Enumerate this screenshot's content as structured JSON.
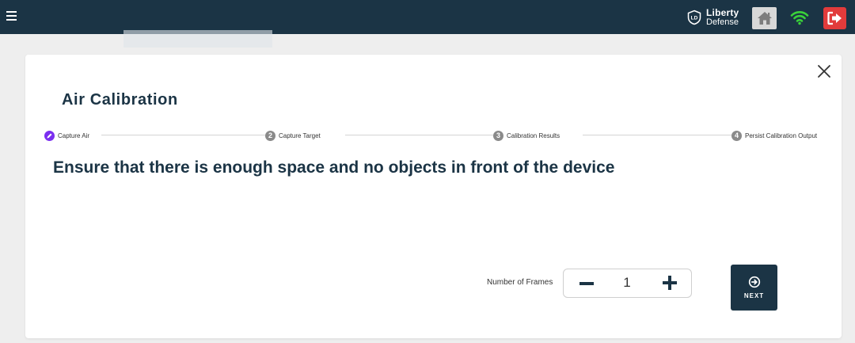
{
  "topbar": {
    "brand": {
      "line1": "Liberty",
      "line2": "Defense",
      "logo_text": "LD"
    },
    "icons": {
      "menu": "hamburger-menu-icon",
      "home": "home-icon",
      "wifi": "wifi-icon",
      "logout": "logout-icon"
    },
    "colors": {
      "bar": "#1b3445",
      "wifi": "#3ad13a",
      "logout": "#e23b3b"
    }
  },
  "modal": {
    "title": "Air Calibration",
    "steps": [
      {
        "number": "1",
        "label": "Capture Air",
        "state": "active"
      },
      {
        "number": "2",
        "label": "Capture Target",
        "state": "pending"
      },
      {
        "number": "3",
        "label": "Calibration Results",
        "state": "pending"
      },
      {
        "number": "4",
        "label": "Persist Calibration Output",
        "state": "pending"
      }
    ],
    "instruction": "Ensure that there is enough space and no objects in front of the device",
    "frames": {
      "label": "Number of Frames",
      "value": "1"
    },
    "next_label": "NEXT"
  }
}
